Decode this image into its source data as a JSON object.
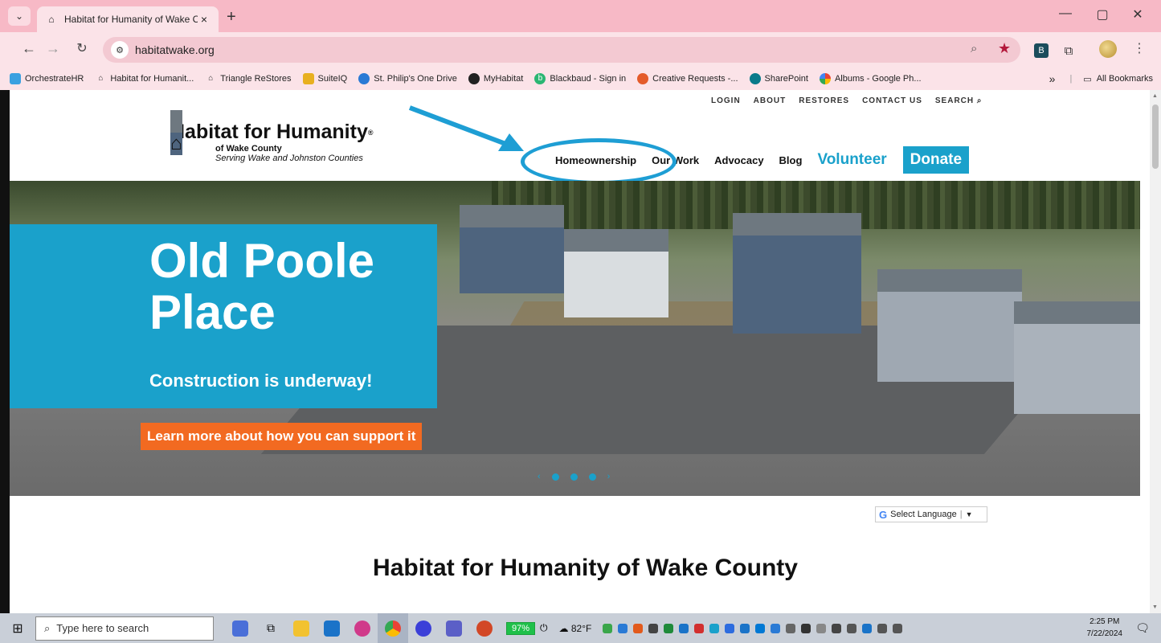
{
  "browser": {
    "tab_title": "Habitat for Humanity of Wake C",
    "new_tab_label": "+",
    "url": "habitatwake.org",
    "window_controls": {
      "minimize": "—",
      "maximize": "▢",
      "close": "✕"
    },
    "bookmarks": [
      {
        "label": "OrchestrateHR",
        "color": "#3aa0e0"
      },
      {
        "label": "Habitat for Humanit...",
        "color": "#333333"
      },
      {
        "label": "Triangle ReStores",
        "color": "#333333"
      },
      {
        "label": "SuiteIQ",
        "color": "#e8b020"
      },
      {
        "label": "St. Philip's One Drive",
        "color": "#2a7ad5"
      },
      {
        "label": "MyHabitat",
        "color": "#222222"
      },
      {
        "label": "Blackbaud - Sign in",
        "color": "#2bb673"
      },
      {
        "label": "Creative Requests -...",
        "color": "#e45b2a"
      },
      {
        "label": "SharePoint",
        "color": "#0a7a8a"
      },
      {
        "label": "Albums - Google Ph...",
        "color": "#fbbc04"
      }
    ],
    "bookmarks_overflow": "»",
    "all_bookmarks": "All Bookmarks"
  },
  "site": {
    "utility_links": [
      "LOGIN",
      "ABOUT",
      "RESTORES",
      "CONTACT US",
      "SEARCH"
    ],
    "logo_main": "Habitat for Humanity",
    "logo_registered": "®",
    "logo_sub1": "of Wake County",
    "logo_sub2": "Serving Wake and Johnston Counties",
    "nav": {
      "homeownership": "Homeownership",
      "our_work": "Our Work",
      "advocacy": "Advocacy",
      "blog": "Blog",
      "volunteer": "Volunteer",
      "donate": "Donate"
    },
    "hero": {
      "title": "Old Poole Place",
      "subtitle": "Construction is underway!",
      "cta": "Learn more about how you can support it",
      "prev": "‹",
      "next": "›"
    },
    "translate_label": "Select Language",
    "translate_arrow": "▼",
    "page_heading": "Habitat for Humanity of Wake County"
  },
  "taskbar": {
    "search_placeholder": "Type here to search",
    "battery": "97%",
    "weather": "82°F",
    "time": "2:25 PM",
    "date": "7/22/2024"
  },
  "colors": {
    "brand_blue": "#1aa1cb",
    "cta_orange": "#f26a21",
    "chrome_pink": "#f7b9c6",
    "annotation_blue": "#1e9ed4"
  }
}
